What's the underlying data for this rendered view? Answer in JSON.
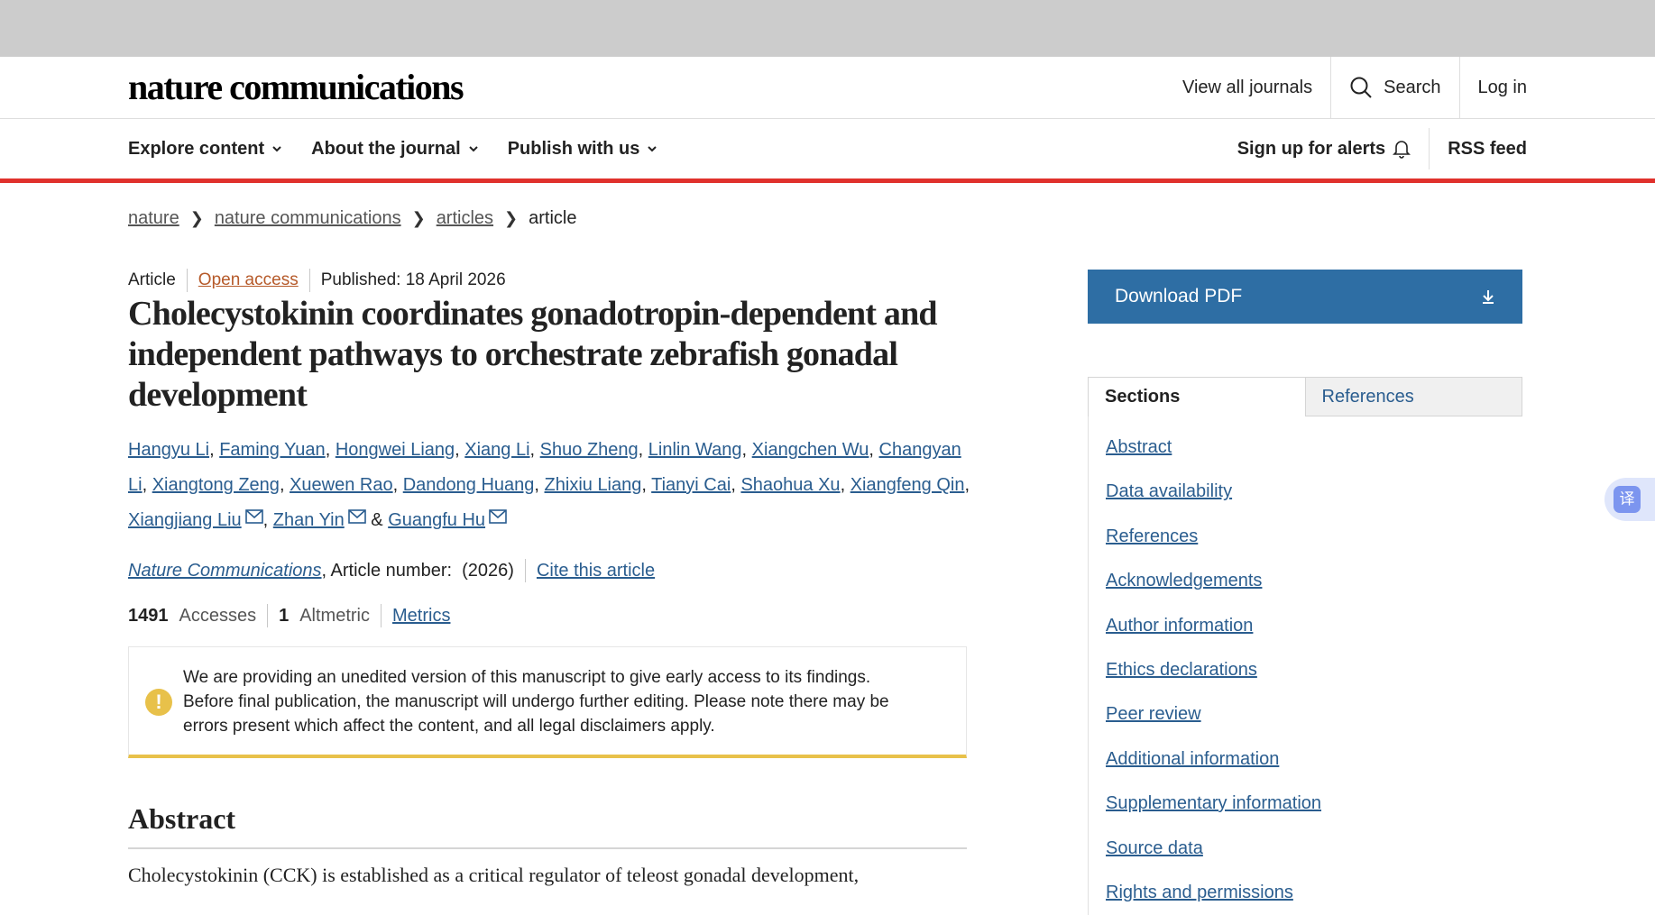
{
  "header": {
    "logo": "nature communications",
    "view_all_journals": "View all journals",
    "search": "Search",
    "login": "Log in"
  },
  "nav": {
    "explore": "Explore content",
    "about": "About the journal",
    "publish": "Publish with us",
    "alerts": "Sign up for alerts",
    "rss": "RSS feed"
  },
  "breadcrumb": [
    "nature",
    "nature communications",
    "articles",
    "article"
  ],
  "article": {
    "type": "Article",
    "open_access": "Open access",
    "published": "Published: 18 April 2026",
    "title": "Cholecystokinin coordinates gonadotropin-dependent and independent pathways to orchestrate zebrafish gonadal development",
    "authors": [
      "Hangyu Li",
      "Faming Yuan",
      "Hongwei Liang",
      "Xiang Li",
      "Shuo Zheng",
      "Linlin Wang",
      "Xiangchen Wu",
      "Changyan Li",
      "Xiangtong Zeng",
      "Xuewen Rao",
      "Dandong Huang",
      "Zhixiu Liang",
      "Tianyi Cai",
      "Shaohua Xu",
      "Xiangfeng Qin",
      "Xiangjiang Liu",
      "Zhan Yin",
      "Guangfu Hu"
    ],
    "journal": "Nature Communications",
    "article_number": ", Article number:  (2026)",
    "cite": "Cite this article",
    "accesses_count": "1491",
    "accesses_label": "Accesses",
    "altmetric_count": "1",
    "altmetric_label": "Altmetric",
    "metrics_link": "Metrics"
  },
  "notice": {
    "text": "We are providing an unedited version of this manuscript to give early access to its findings. Before final publication, the manuscript will undergo further editing. Please note there may be errors present which affect the content, and all legal disclaimers apply."
  },
  "abstract": {
    "heading": "Abstract",
    "text": "Cholecystokinin (CCK) is established as a critical regulator of teleost gonadal development,"
  },
  "sidebar": {
    "download_pdf": "Download PDF",
    "tab_sections": "Sections",
    "tab_references": "References",
    "sections": [
      "Abstract",
      "Data availability",
      "References",
      "Acknowledgements",
      "Author information",
      "Ethics declarations",
      "Peer review",
      "Additional information",
      "Supplementary information",
      "Source data",
      "Rights and permissions"
    ]
  },
  "translate_button": "译",
  "colors": {
    "accent_red": "#e0312c",
    "link_blue": "#2a5d8f",
    "pdf_button": "#2e6ea4",
    "notice_yellow": "#e8c14a"
  }
}
